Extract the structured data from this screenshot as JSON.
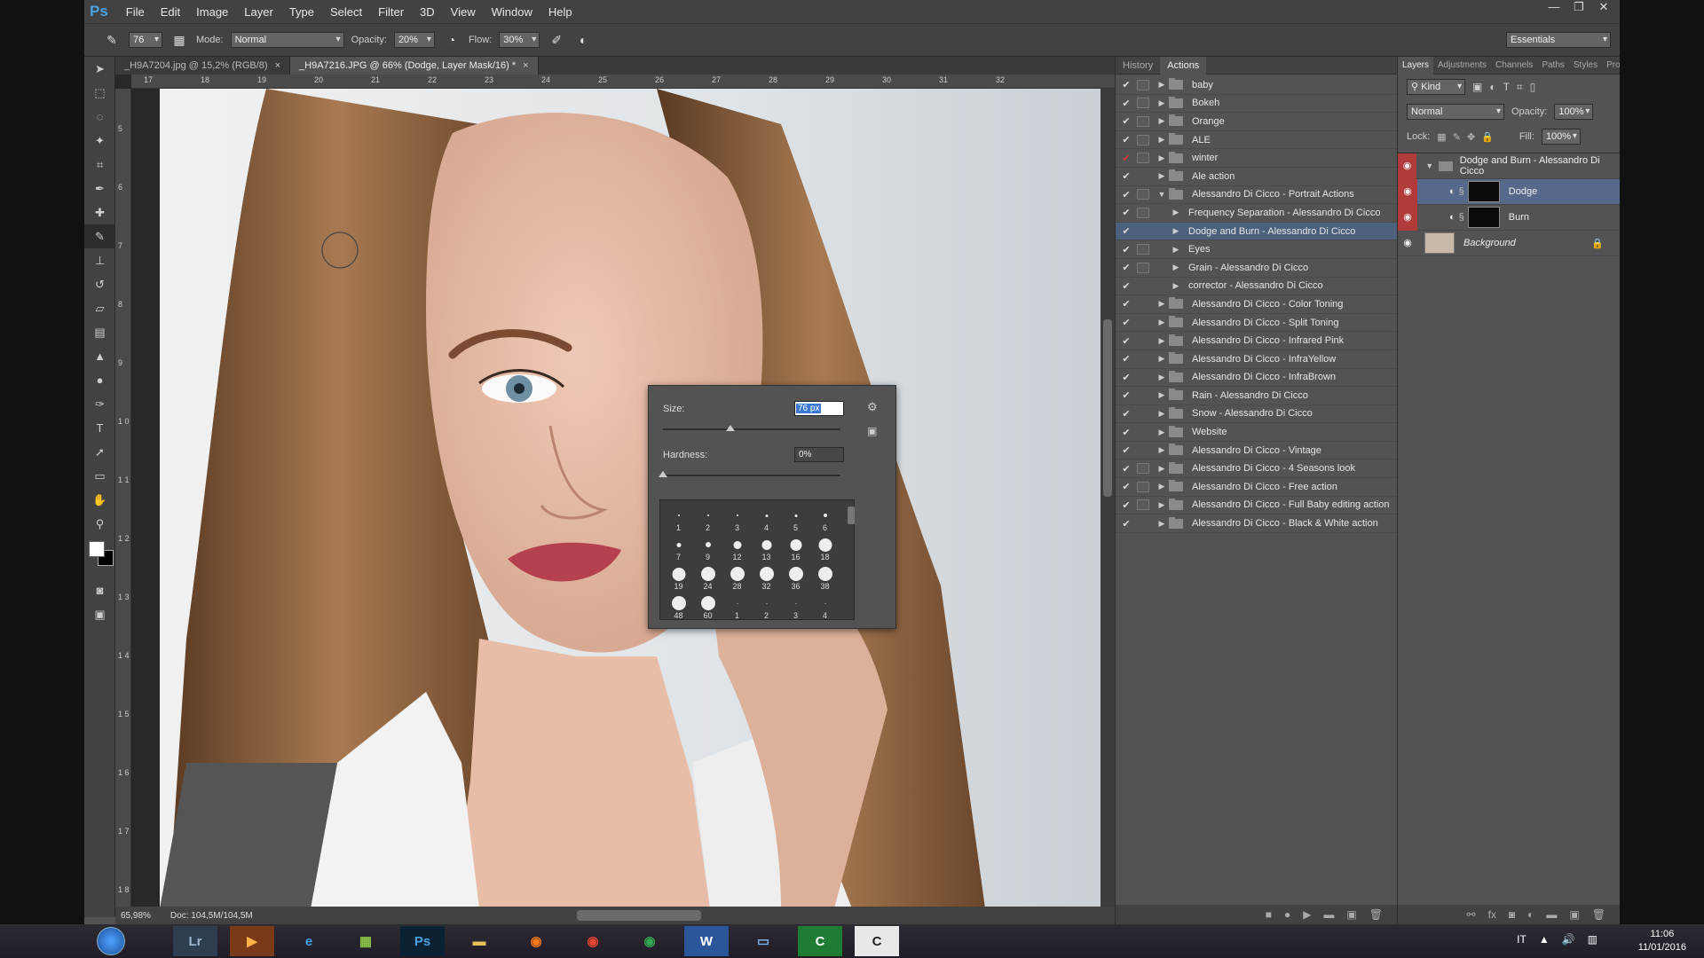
{
  "app": {
    "logo": "Ps"
  },
  "menu": [
    "File",
    "Edit",
    "Image",
    "Layer",
    "Type",
    "Select",
    "Filter",
    "3D",
    "View",
    "Window",
    "Help"
  ],
  "window_controls": [
    "—",
    "❐",
    "✕"
  ],
  "options": {
    "brush_size": "76",
    "mode_label": "Mode:",
    "mode_value": "Normal",
    "opacity_label": "Opacity:",
    "opacity_value": "20%",
    "flow_label": "Flow:",
    "flow_value": "30%",
    "workspace": "Essentials"
  },
  "doc_tabs": [
    {
      "label": "_H9A7204.jpg @ 15,2% (RGB/8)",
      "close": "×"
    },
    {
      "label": "_H9A7216.JPG @ 66% (Dodge, Layer Mask/16) *",
      "close": "×"
    }
  ],
  "ruler": {
    "h": [
      "17",
      "18",
      "19",
      "20",
      "21",
      "22",
      "23",
      "24",
      "25",
      "26",
      "27",
      "28",
      "29",
      "30",
      "31",
      "32"
    ],
    "v": [
      "5",
      "6",
      "7",
      "8",
      "9",
      "1 0",
      "1 1",
      "1 2",
      "1 3",
      "1 4",
      "1 5",
      "1 6",
      "1 7",
      "1 8"
    ]
  },
  "status": {
    "zoom": "65,98%",
    "doc": "Doc: 104,5M/104,5M"
  },
  "brush_popup": {
    "size_label": "Size:",
    "size_value": "76 px",
    "hardness_label": "Hardness:",
    "hardness_value": "0%",
    "size_fraction": 0.38,
    "hardness_fraction": 0.0,
    "presets": [
      {
        "n": "1",
        "d": 2
      },
      {
        "n": "2",
        "d": 2
      },
      {
        "n": "3",
        "d": 2
      },
      {
        "n": "4",
        "d": 3
      },
      {
        "n": "5",
        "d": 3
      },
      {
        "n": "6",
        "d": 4
      },
      {
        "n": "7",
        "d": 5
      },
      {
        "n": "9",
        "d": 6
      },
      {
        "n": "12",
        "d": 9
      },
      {
        "n": "13",
        "d": 11
      },
      {
        "n": "16",
        "d": 13
      },
      {
        "n": "18",
        "d": 15
      },
      {
        "n": "19",
        "d": 15
      },
      {
        "n": "24",
        "d": 16
      },
      {
        "n": "28",
        "d": 16
      },
      {
        "n": "32",
        "d": 16
      },
      {
        "n": "36",
        "d": 16
      },
      {
        "n": "38",
        "d": 16
      },
      {
        "n": "48",
        "d": 16
      },
      {
        "n": "60",
        "d": 16
      },
      {
        "n": "1",
        "d": 1
      },
      {
        "n": "2",
        "d": 1
      },
      {
        "n": "3",
        "d": 1
      },
      {
        "n": "4",
        "d": 1
      }
    ]
  },
  "history_panel": {
    "tabs": [
      "History",
      "Actions"
    ],
    "actions": [
      {
        "label": "baby",
        "level": 0,
        "dialog": true,
        "open": false
      },
      {
        "label": "Bokeh",
        "level": 0,
        "dialog": true,
        "open": false
      },
      {
        "label": "Orange",
        "level": 0,
        "dialog": true,
        "open": false
      },
      {
        "label": "ALE",
        "level": 0,
        "dialog": true,
        "open": false
      },
      {
        "label": "winter",
        "level": 0,
        "dialog": true,
        "open": false,
        "red": true
      },
      {
        "label": "Ale action",
        "level": 0,
        "dialog": false,
        "open": false
      },
      {
        "label": "Alessandro Di Cicco - Portrait Actions",
        "level": 0,
        "dialog": true,
        "open": true
      },
      {
        "label": "Frequency Separation - Alessandro Di Cicco",
        "level": 1,
        "dialog": true
      },
      {
        "label": "Dodge and Burn - Alessandro Di Cicco",
        "level": 1,
        "dialog": false,
        "selected": true
      },
      {
        "label": "Eyes",
        "level": 1,
        "dialog": true
      },
      {
        "label": "Grain - Alessandro Di Cicco",
        "level": 1,
        "dialog": true
      },
      {
        "label": "corrector - Alessandro Di Cicco",
        "level": 1,
        "dialog": false
      },
      {
        "label": "Alessandro Di Cicco - Color Toning",
        "level": 0,
        "dialog": false,
        "open": false
      },
      {
        "label": "Alessandro Di Cicco - Split Toning",
        "level": 0,
        "dialog": false,
        "open": false
      },
      {
        "label": "Alessandro Di Cicco - Infrared Pink",
        "level": 0,
        "dialog": false,
        "open": false
      },
      {
        "label": "Alessandro Di Cicco - InfraYellow",
        "level": 0,
        "dialog": false,
        "open": false
      },
      {
        "label": "Alessandro Di Cicco - InfraBrown",
        "level": 0,
        "dialog": false,
        "open": false
      },
      {
        "label": "Rain - Alessandro Di Cicco",
        "level": 0,
        "dialog": false,
        "open": false
      },
      {
        "label": "Snow - Alessandro Di Cicco",
        "level": 0,
        "dialog": false,
        "open": false
      },
      {
        "label": "Website",
        "level": 0,
        "dialog": false,
        "open": false
      },
      {
        "label": "Alessandro Di Cicco - Vintage",
        "level": 0,
        "dialog": false,
        "open": false
      },
      {
        "label": "Alessandro Di Cicco - 4 Seasons look",
        "level": 0,
        "dialog": true,
        "open": false
      },
      {
        "label": "Alessandro Di Cicco - Free action",
        "level": 0,
        "dialog": true,
        "open": false
      },
      {
        "label": "Alessandro Di Cicco - Full Baby editing action",
        "level": 0,
        "dialog": true,
        "open": false
      },
      {
        "label": "Alessandro Di Cicco - Black & White action",
        "level": 0,
        "dialog": false,
        "open": false
      }
    ]
  },
  "layers_panel": {
    "tabs": [
      "Layers",
      "Adjustments",
      "Channels",
      "Paths",
      "Styles",
      "Properties"
    ],
    "kind": "Kind",
    "blend": "Normal",
    "opacity_label": "Opacity:",
    "opacity_value": "100%",
    "lock_label": "Lock:",
    "fill_label": "Fill:",
    "fill_value": "100%",
    "group": "Dodge and Burn - Alessandro Di Cicco",
    "layers": [
      {
        "label": "Dodge",
        "selected": true
      },
      {
        "label": "Burn",
        "selected": false
      }
    ],
    "background": "Background"
  },
  "taskbar": {
    "apps": [
      {
        "label": "Lr",
        "color": "#2c3e50",
        "fg": "#9fb7d0"
      },
      {
        "label": "▶",
        "color": "#7a3a1a",
        "fg": "#ffb347"
      },
      {
        "label": "e",
        "color": "transparent",
        "fg": "#3ea0e6"
      },
      {
        "label": "▦",
        "color": "transparent",
        "fg": "#8bc34a"
      },
      {
        "label": "Ps",
        "color": "#0b2234",
        "fg": "#4aa3df"
      },
      {
        "label": "▬",
        "color": "transparent",
        "fg": "#e6c15a"
      },
      {
        "label": "◉",
        "color": "transparent",
        "fg": "#ff7a1a"
      },
      {
        "label": "◉",
        "color": "transparent",
        "fg": "#e84335"
      },
      {
        "label": "◉",
        "color": "transparent",
        "fg": "#34a853"
      },
      {
        "label": "W",
        "color": "#2b579a",
        "fg": "#ffffff"
      },
      {
        "label": "▭",
        "color": "transparent",
        "fg": "#7fb0e0"
      },
      {
        "label": "C",
        "color": "#1e7d32",
        "fg": "#ffffff"
      },
      {
        "label": "C",
        "color": "#e8e8e8",
        "fg": "#222222"
      }
    ],
    "lang": "IT",
    "time": "11:06",
    "date": "11/01/2016"
  }
}
